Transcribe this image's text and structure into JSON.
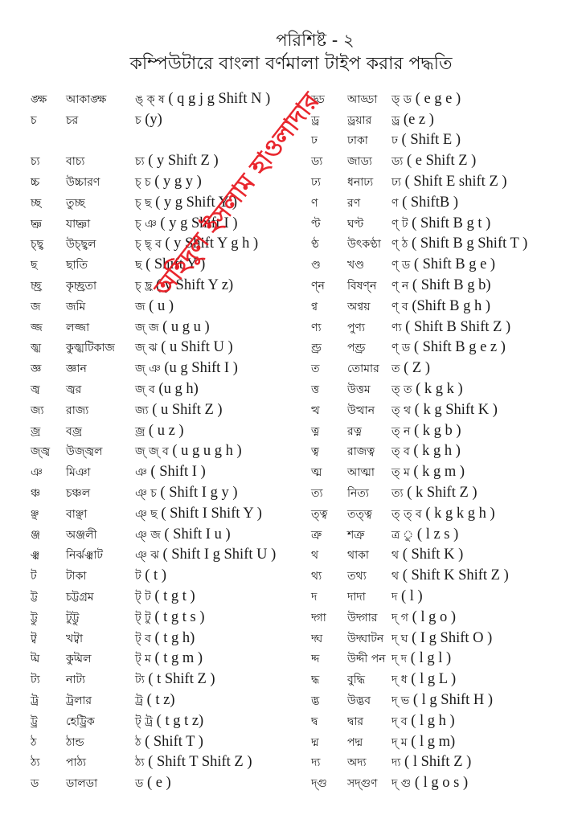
{
  "header": {
    "appendix": "পরিশিষ্ট - ২",
    "title": "কম্পিউটারে বাংলা বর্ণমালা টাইপ করার পদ্ধতি"
  },
  "watermark": "অহিদুল ইসলাম হাওলাদার",
  "left_table": [
    {
      "char": "ঙ্ক্ষ",
      "word": "আকাঙ্ক্ষ",
      "typed": "ঙ্ ক্ ষ",
      "keys": "( q g j g Shift N )"
    },
    {
      "char": "চ",
      "word": "চর",
      "typed": "চ",
      "keys": "(y)"
    },
    {
      "char": "",
      "word": "",
      "typed": "",
      "keys": ""
    },
    {
      "char": "চ্য",
      "word": "বাচ্য",
      "typed": "চ্য",
      "keys": "( y Shift Z )"
    },
    {
      "char": "চ্চ",
      "word": "উচ্চারণ",
      "typed": "চ্ চ",
      "keys": "( y g y )"
    },
    {
      "char": "চ্ছ",
      "word": "তুচ্ছ",
      "typed": "চ্ ছ",
      "keys": "( y g Shift Y )"
    },
    {
      "char": "চ্ঞ",
      "word": "যাচ্ঞা",
      "typed": "চ্ ঞ",
      "keys": "( y g Shift I )"
    },
    {
      "char": "চ্ছ্ব",
      "word": "উচ্ছ্বল",
      "typed": "চ্ ছ্ ব",
      "keys": "( y Shift Y g h )"
    },
    {
      "char": "ছ",
      "word": "ছাতি",
      "typed": "ছ",
      "keys": "( Shift Y )"
    },
    {
      "char": "চ্ছ্র",
      "word": "কৃচ্ছ্রতা",
      "typed": "চ্ ছ্র",
      "keys": "( y Shift Y z)"
    },
    {
      "char": "জ",
      "word": "জমি",
      "typed": "জ",
      "keys": "( u )"
    },
    {
      "char": "জ্জ",
      "word": "লজ্জা",
      "typed": "জ্ জ",
      "keys": "( u g u )"
    },
    {
      "char": "জ্ঝ",
      "word": "কুজ্ঝটিকাজ",
      "typed": "জ্ ঝ",
      "keys": "( u Shift U )"
    },
    {
      "char": "জ্ঞ",
      "word": "জ্ঞান",
      "typed": "জ্ ঞ",
      "keys": "(u g Shift I )"
    },
    {
      "char": "জ্ব",
      "word": "জ্বর",
      "typed": "জ্ ব",
      "keys": "(u g h)"
    },
    {
      "char": "জ্য",
      "word": "রাজ্য",
      "typed": "জ্য",
      "keys": "( u Shift Z )"
    },
    {
      "char": "জ্র",
      "word": "বজ্র",
      "typed": "জ্র",
      "keys": "( u z )"
    },
    {
      "char": "জ্জ্ব",
      "word": "উজ্জ্বল",
      "typed": "জ্ জ্ ব",
      "keys": "( u g u g h )"
    },
    {
      "char": "ঞ",
      "word": "মিঞা",
      "typed": "ঞ",
      "keys": "( Shift I )"
    },
    {
      "char": "ঞ্চ",
      "word": "চঞ্চল",
      "typed": "ঞ্ চ",
      "keys": "( Shift I g y )"
    },
    {
      "char": "ঞ্ছ",
      "word": "বাঞ্ছা",
      "typed": "ঞ্ ছ",
      "keys": "( Shift I Shift Y )"
    },
    {
      "char": "ঞ্জ",
      "word": "অঞ্জলী",
      "typed": "ঞ্ জ",
      "keys": "( Shift I u )"
    },
    {
      "char": "ঞ্ঝ",
      "word": "নির্ঝঞ্ঝাট",
      "typed": "ঞ্ ঝ",
      "keys": "( Shift I g Shift U )"
    },
    {
      "char": "ট",
      "word": "টাকা",
      "typed": "ট",
      "keys": "( t )"
    },
    {
      "char": "ট্ট",
      "word": "চট্টগ্রম",
      "typed": "ট্ ট",
      "keys": "( t g t )"
    },
    {
      "char": "ট্টু",
      "word": "টুট্টু",
      "typed": "ট্ টু",
      "keys": "( t g t s )"
    },
    {
      "char": "ট্ব",
      "word": "খট্বা",
      "typed": "ট্ ব",
      "keys": "( t g h)"
    },
    {
      "char": "ট্ম",
      "word": "কুট্মল",
      "typed": "ট্ ম",
      "keys": "( t g m )"
    },
    {
      "char": "ট্য",
      "word": "নাট্য",
      "typed": "ট্য",
      "keys": "( t Shift Z )"
    },
    {
      "char": "ট্র",
      "word": "ট্রলার",
      "typed": "ট্র",
      "keys": "( t z)"
    },
    {
      "char": "ট্ট্র",
      "word": "হেট্ট্রিক",
      "typed": "ট্ ট্র",
      "keys": "( t g t z)"
    },
    {
      "char": "ঠ",
      "word": "ঠান্ড",
      "typed": "ঠ",
      "keys": "( Shift T )"
    },
    {
      "char": "ঠ্য",
      "word": "পাঠ্য",
      "typed": "ঠ্য",
      "keys": "( Shift T Shift Z )"
    },
    {
      "char": "ড",
      "word": "ডালডা",
      "typed": "ড",
      "keys": "( e )"
    }
  ],
  "right_table": [
    {
      "char": "ড্ড",
      "word": "আড্ডা",
      "typed": "ড্ ড",
      "keys": "( e g e )"
    },
    {
      "char": "ড্র",
      "word": "ড্রয়ার",
      "typed": "ড্র",
      "keys": "(e z )"
    },
    {
      "char": "ঢ",
      "word": "ঢাকা",
      "typed": "ঢ",
      "keys": "( Shift E )"
    },
    {
      "char": "ড্য",
      "word": "জাড্য",
      "typed": "ড্য",
      "keys": "( e Shift Z )"
    },
    {
      "char": "ঢ্য",
      "word": "ধনাঢ্য",
      "typed": "ঢ্য",
      "keys": "( Shift E shift Z )"
    },
    {
      "char": "ণ",
      "word": "রণ",
      "typed": "ণ",
      "keys": "( ShiftB )"
    },
    {
      "char": "ণ্ট",
      "word": "ঘণ্ট",
      "typed": "ণ্ ট",
      "keys": "( Shift B g t )"
    },
    {
      "char": "ণ্ঠ",
      "word": "উৎকণ্ঠা",
      "typed": "ণ্ ঠ",
      "keys": "( Shift B g Shift T )"
    },
    {
      "char": "ণ্ড",
      "word": "খণ্ড",
      "typed": "ণ্ ড",
      "keys": "( Shift B g e )"
    },
    {
      "char": "ণ্ন",
      "word": "বিষণ্ন",
      "typed": "ণ্ ন",
      "keys": "( Shift B g b)"
    },
    {
      "char": "ণ্ব",
      "word": "অণ্বয়",
      "typed": "ণ্ ব",
      "keys": "(Shift B g h )"
    },
    {
      "char": "ণ্য",
      "word": "পুণ্য",
      "typed": "ণ্য",
      "keys": "( Shift B Shift Z )"
    },
    {
      "char": "ণ্ড্র",
      "word": "পণ্ড্র",
      "typed": "ণ্ ড",
      "keys": "( Shift B g e z )"
    },
    {
      "char": "ত",
      "word": "তোমার",
      "typed": "ত",
      "keys": "( Z )"
    },
    {
      "char": "ত্ত",
      "word": "উত্তম",
      "typed": "ত্ ত",
      "keys": "( k g k )"
    },
    {
      "char": "ত্থ",
      "word": "উত্থান",
      "typed": "ত্ থ",
      "keys": "( k g Shift K )"
    },
    {
      "char": "ত্ন",
      "word": "রত্ন",
      "typed": "ত্ ন",
      "keys": "( k g b )"
    },
    {
      "char": "ত্ব",
      "word": "রাজত্ব",
      "typed": "ত্ ব",
      "keys": "( k g h )"
    },
    {
      "char": "ত্ম",
      "word": "আত্মা",
      "typed": "ত্ ম",
      "keys": "( k g m )"
    },
    {
      "char": "ত্য",
      "word": "নিত্য",
      "typed": "ত্য",
      "keys": "( k Shift Z )"
    },
    {
      "char": "ত্ত্ব",
      "word": "তত্ত্ব",
      "typed": "ত্ ত্ ব",
      "keys": "( k g k g h )"
    },
    {
      "char": "ত্রু",
      "word": "শত্রু",
      "typed": "ত্র ু",
      "keys": "( l z s )"
    },
    {
      "char": "থ",
      "word": "থাকা",
      "typed": "থ",
      "keys": "( Shift K )"
    },
    {
      "char": "থ্য",
      "word": "তথ্য",
      "typed": "থ",
      "keys": "( Shift K Shift Z )"
    },
    {
      "char": "দ",
      "word": "দাদা",
      "typed": "দ",
      "keys": "( l )"
    },
    {
      "char": "দ্গা",
      "word": "উদ্গার",
      "typed": "দ্ গ",
      "keys": "( l g o )"
    },
    {
      "char": "দ্ঘ",
      "word": "উদ্ঘাটন",
      "typed": "দ্ ঘ",
      "keys": "( I g Shift O )"
    },
    {
      "char": "দ্দ",
      "word": "উদ্দী পন",
      "typed": "দ্ দ",
      "keys": "( l g l )"
    },
    {
      "char": "দ্ধ",
      "word": "বুদ্ধি",
      "typed": "দ্ ধ",
      "keys": "( l g L )"
    },
    {
      "char": "দ্ভ",
      "word": "উদ্ভব",
      "typed": "দ্ ভ",
      "keys": "( l g Shift H )"
    },
    {
      "char": "দ্ব",
      "word": "দ্বার",
      "typed": "দ্ ব",
      "keys": "( l g h )"
    },
    {
      "char": "দ্ম",
      "word": "পদ্ম",
      "typed": "দ্ ম",
      "keys": "( l g m)"
    },
    {
      "char": "দ্য",
      "word": "অদ্য",
      "typed": "দ্য",
      "keys": "( l Shift Z )"
    },
    {
      "char": "দ্গু",
      "word": "সদ্গুণ",
      "typed": "দ্ গু",
      "keys": "( l g o s )"
    }
  ]
}
